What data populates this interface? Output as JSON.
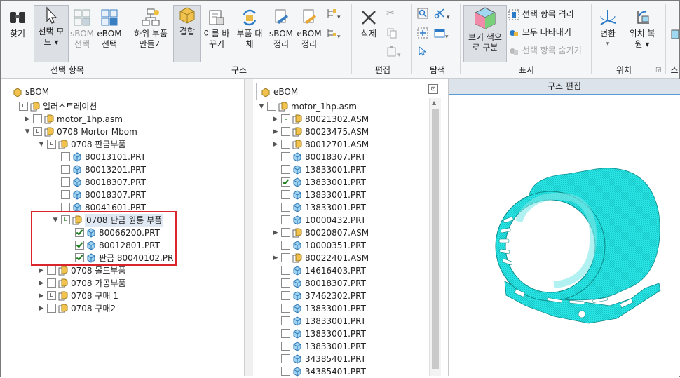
{
  "ribbon": {
    "find": "찾기",
    "select_mode": [
      "선택 모",
      "드 ▾"
    ],
    "sbom_select": [
      "sBOM",
      "선택"
    ],
    "ebom_select": [
      "eBOM",
      "선택"
    ],
    "group_select": "선택 항목",
    "make_sub": [
      "하위 부품",
      "만들기"
    ],
    "combine": "결합",
    "rename": [
      "이름 바",
      "꾸기"
    ],
    "replace": [
      "부품 대",
      "체"
    ],
    "sbom_arrange": [
      "sBOM",
      "정리"
    ],
    "ebom_arrange": [
      "eBOM",
      "정리"
    ],
    "group_structure": "구조",
    "delete": "삭제",
    "group_edit": "편집",
    "group_explore": "탐색",
    "view_color": [
      "보기 색으",
      "로 구분"
    ],
    "isolate": "선택 항목 격리",
    "show_all": "모두 나타내기",
    "hide_selected": "선택 항목 숨기기",
    "group_display": "표시",
    "transform": "변환",
    "reposition": [
      "위치 복",
      "원 ▾"
    ],
    "group_position": "위치",
    "group_cut": "스"
  },
  "sbom": {
    "tab": "sBOM",
    "items": [
      {
        "label": "일러스트레이션",
        "indent": 0,
        "expander": "",
        "check": "badge",
        "icon": "asm"
      },
      {
        "label": "motor_1hp.asm",
        "indent": 1,
        "expander": "▶",
        "check": "off",
        "icon": "asm"
      },
      {
        "label": "0708 Mortor Mbom",
        "indent": 1,
        "expander": "▼",
        "check": "badge",
        "icon": "asm"
      },
      {
        "label": "0708 판금부품",
        "indent": 2,
        "expander": "▼",
        "check": "badge",
        "icon": "asm-open"
      },
      {
        "label": "80013101.PRT",
        "indent": 3,
        "expander": "",
        "check": "off",
        "icon": "part"
      },
      {
        "label": "80013201.PRT",
        "indent": 3,
        "expander": "",
        "check": "off",
        "icon": "part"
      },
      {
        "label": "80018307.PRT",
        "indent": 3,
        "expander": "",
        "check": "off",
        "icon": "part"
      },
      {
        "label": "80018307.PRT",
        "indent": 3,
        "expander": "",
        "check": "off",
        "icon": "part"
      },
      {
        "label": "80041601.PRT",
        "indent": 3,
        "expander": "",
        "check": "off",
        "icon": "part"
      },
      {
        "label": "0708 판금 원통 부품",
        "indent": 3,
        "expander": "▼",
        "check": "badge-green",
        "icon": "asm-combine",
        "selected": true
      },
      {
        "label": "80066200.PRT",
        "indent": 4,
        "expander": "",
        "check": "on",
        "icon": "part"
      },
      {
        "label": "80012801.PRT",
        "indent": 4,
        "expander": "",
        "check": "on",
        "icon": "part"
      },
      {
        "label": "판금 80040102.PRT",
        "indent": 4,
        "expander": "",
        "check": "on",
        "icon": "part"
      },
      {
        "label": "0708 몰드부품",
        "indent": 2,
        "expander": "▶",
        "check": "off",
        "icon": "asm"
      },
      {
        "label": "0708 가공부품",
        "indent": 2,
        "expander": "▶",
        "check": "off",
        "icon": "asm"
      },
      {
        "label": "0708 구매 1",
        "indent": 2,
        "expander": "▶",
        "check": "badge",
        "icon": "asm"
      },
      {
        "label": "0708 구매2",
        "indent": 2,
        "expander": "▶",
        "check": "off",
        "icon": "asm"
      }
    ]
  },
  "ebom": {
    "tab": "eBOM",
    "items": [
      {
        "label": "motor_1hp.asm",
        "indent": 0,
        "expander": "▼",
        "check": "badge",
        "icon": "asm"
      },
      {
        "label": "80021302.ASM",
        "indent": 1,
        "expander": "▶",
        "check": "badge-green",
        "icon": "asm"
      },
      {
        "label": "80023475.ASM",
        "indent": 1,
        "expander": "▶",
        "check": "off",
        "icon": "asm"
      },
      {
        "label": "80012701.ASM",
        "indent": 1,
        "expander": "▶",
        "check": "off",
        "icon": "asm"
      },
      {
        "label": "80018307.PRT",
        "indent": 1,
        "expander": "",
        "check": "off",
        "icon": "part"
      },
      {
        "label": "13833001.PRT",
        "indent": 1,
        "expander": "",
        "check": "off",
        "icon": "part"
      },
      {
        "label": "13833001.PRT",
        "indent": 1,
        "expander": "",
        "check": "on",
        "icon": "part"
      },
      {
        "label": "13833001.PRT",
        "indent": 1,
        "expander": "",
        "check": "off",
        "icon": "part"
      },
      {
        "label": "13833001.PRT",
        "indent": 1,
        "expander": "",
        "check": "off",
        "icon": "part"
      },
      {
        "label": "10000432.PRT",
        "indent": 1,
        "expander": "",
        "check": "off",
        "icon": "part"
      },
      {
        "label": "80020807.ASM",
        "indent": 1,
        "expander": "▶",
        "check": "off",
        "icon": "asm"
      },
      {
        "label": "10000351.PRT",
        "indent": 1,
        "expander": "",
        "check": "off",
        "icon": "part"
      },
      {
        "label": "80022401.ASM",
        "indent": 1,
        "expander": "▶",
        "check": "off",
        "icon": "asm"
      },
      {
        "label": "14616403.PRT",
        "indent": 1,
        "expander": "",
        "check": "off",
        "icon": "part"
      },
      {
        "label": "80018307.PRT",
        "indent": 1,
        "expander": "",
        "check": "off",
        "icon": "part"
      },
      {
        "label": "37462302.PRT",
        "indent": 1,
        "expander": "",
        "check": "off",
        "icon": "part"
      },
      {
        "label": "13833001.PRT",
        "indent": 1,
        "expander": "",
        "check": "off",
        "icon": "part"
      },
      {
        "label": "13833001.PRT",
        "indent": 1,
        "expander": "",
        "check": "off",
        "icon": "part"
      },
      {
        "label": "13833001.PRT",
        "indent": 1,
        "expander": "",
        "check": "off",
        "icon": "part"
      },
      {
        "label": "13833001.PRT",
        "indent": 1,
        "expander": "",
        "check": "off",
        "icon": "part"
      },
      {
        "label": "34385401.PRT",
        "indent": 1,
        "expander": "",
        "check": "off",
        "icon": "part"
      },
      {
        "label": "34385401.PRT",
        "indent": 1,
        "expander": "",
        "check": "off",
        "icon": "part"
      }
    ]
  },
  "struct_edit": {
    "header": "구조 편집"
  },
  "colors": {
    "accent": "#5a9bd5",
    "model": "#22e0e0",
    "highlight": "#d9262a"
  }
}
